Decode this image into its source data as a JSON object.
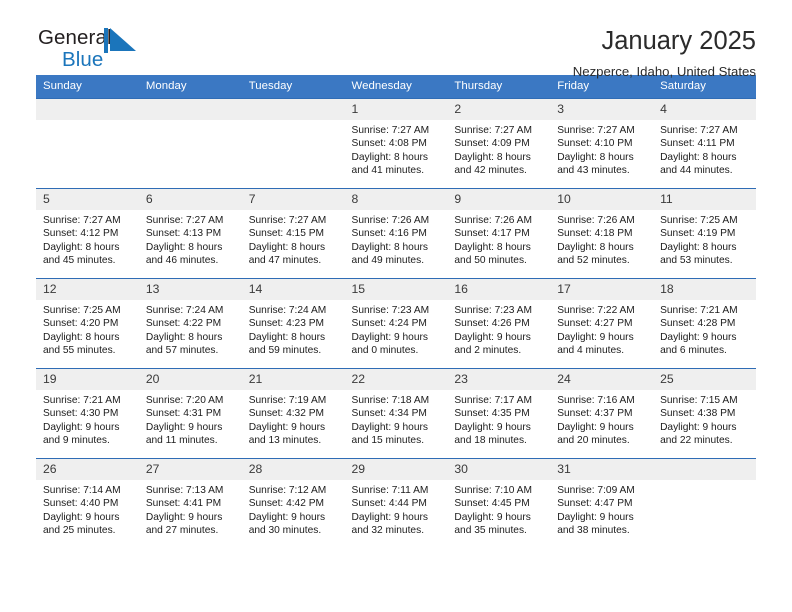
{
  "brand": {
    "name_part1": "General",
    "name_part2": "Blue",
    "mark_icon": "triangle-flag-icon",
    "accent_color": "#1b75bb"
  },
  "header": {
    "title": "January 2025",
    "subtitle": "Nezperce, Idaho, United States"
  },
  "theme": {
    "header_bar_color": "#3b78c3",
    "day_band_color": "#efefef",
    "row_rule_color": "#2f6cb5"
  },
  "weekdays": [
    "Sunday",
    "Monday",
    "Tuesday",
    "Wednesday",
    "Thursday",
    "Friday",
    "Saturday"
  ],
  "weeks": [
    [
      {
        "day": "",
        "lines": []
      },
      {
        "day": "",
        "lines": []
      },
      {
        "day": "",
        "lines": []
      },
      {
        "day": "1",
        "lines": [
          "Sunrise: 7:27 AM",
          "Sunset: 4:08 PM",
          "Daylight: 8 hours",
          "and 41 minutes."
        ]
      },
      {
        "day": "2",
        "lines": [
          "Sunrise: 7:27 AM",
          "Sunset: 4:09 PM",
          "Daylight: 8 hours",
          "and 42 minutes."
        ]
      },
      {
        "day": "3",
        "lines": [
          "Sunrise: 7:27 AM",
          "Sunset: 4:10 PM",
          "Daylight: 8 hours",
          "and 43 minutes."
        ]
      },
      {
        "day": "4",
        "lines": [
          "Sunrise: 7:27 AM",
          "Sunset: 4:11 PM",
          "Daylight: 8 hours",
          "and 44 minutes."
        ]
      }
    ],
    [
      {
        "day": "5",
        "lines": [
          "Sunrise: 7:27 AM",
          "Sunset: 4:12 PM",
          "Daylight: 8 hours",
          "and 45 minutes."
        ]
      },
      {
        "day": "6",
        "lines": [
          "Sunrise: 7:27 AM",
          "Sunset: 4:13 PM",
          "Daylight: 8 hours",
          "and 46 minutes."
        ]
      },
      {
        "day": "7",
        "lines": [
          "Sunrise: 7:27 AM",
          "Sunset: 4:15 PM",
          "Daylight: 8 hours",
          "and 47 minutes."
        ]
      },
      {
        "day": "8",
        "lines": [
          "Sunrise: 7:26 AM",
          "Sunset: 4:16 PM",
          "Daylight: 8 hours",
          "and 49 minutes."
        ]
      },
      {
        "day": "9",
        "lines": [
          "Sunrise: 7:26 AM",
          "Sunset: 4:17 PM",
          "Daylight: 8 hours",
          "and 50 minutes."
        ]
      },
      {
        "day": "10",
        "lines": [
          "Sunrise: 7:26 AM",
          "Sunset: 4:18 PM",
          "Daylight: 8 hours",
          "and 52 minutes."
        ]
      },
      {
        "day": "11",
        "lines": [
          "Sunrise: 7:25 AM",
          "Sunset: 4:19 PM",
          "Daylight: 8 hours",
          "and 53 minutes."
        ]
      }
    ],
    [
      {
        "day": "12",
        "lines": [
          "Sunrise: 7:25 AM",
          "Sunset: 4:20 PM",
          "Daylight: 8 hours",
          "and 55 minutes."
        ]
      },
      {
        "day": "13",
        "lines": [
          "Sunrise: 7:24 AM",
          "Sunset: 4:22 PM",
          "Daylight: 8 hours",
          "and 57 minutes."
        ]
      },
      {
        "day": "14",
        "lines": [
          "Sunrise: 7:24 AM",
          "Sunset: 4:23 PM",
          "Daylight: 8 hours",
          "and 59 minutes."
        ]
      },
      {
        "day": "15",
        "lines": [
          "Sunrise: 7:23 AM",
          "Sunset: 4:24 PM",
          "Daylight: 9 hours",
          "and 0 minutes."
        ]
      },
      {
        "day": "16",
        "lines": [
          "Sunrise: 7:23 AM",
          "Sunset: 4:26 PM",
          "Daylight: 9 hours",
          "and 2 minutes."
        ]
      },
      {
        "day": "17",
        "lines": [
          "Sunrise: 7:22 AM",
          "Sunset: 4:27 PM",
          "Daylight: 9 hours",
          "and 4 minutes."
        ]
      },
      {
        "day": "18",
        "lines": [
          "Sunrise: 7:21 AM",
          "Sunset: 4:28 PM",
          "Daylight: 9 hours",
          "and 6 minutes."
        ]
      }
    ],
    [
      {
        "day": "19",
        "lines": [
          "Sunrise: 7:21 AM",
          "Sunset: 4:30 PM",
          "Daylight: 9 hours",
          "and 9 minutes."
        ]
      },
      {
        "day": "20",
        "lines": [
          "Sunrise: 7:20 AM",
          "Sunset: 4:31 PM",
          "Daylight: 9 hours",
          "and 11 minutes."
        ]
      },
      {
        "day": "21",
        "lines": [
          "Sunrise: 7:19 AM",
          "Sunset: 4:32 PM",
          "Daylight: 9 hours",
          "and 13 minutes."
        ]
      },
      {
        "day": "22",
        "lines": [
          "Sunrise: 7:18 AM",
          "Sunset: 4:34 PM",
          "Daylight: 9 hours",
          "and 15 minutes."
        ]
      },
      {
        "day": "23",
        "lines": [
          "Sunrise: 7:17 AM",
          "Sunset: 4:35 PM",
          "Daylight: 9 hours",
          "and 18 minutes."
        ]
      },
      {
        "day": "24",
        "lines": [
          "Sunrise: 7:16 AM",
          "Sunset: 4:37 PM",
          "Daylight: 9 hours",
          "and 20 minutes."
        ]
      },
      {
        "day": "25",
        "lines": [
          "Sunrise: 7:15 AM",
          "Sunset: 4:38 PM",
          "Daylight: 9 hours",
          "and 22 minutes."
        ]
      }
    ],
    [
      {
        "day": "26",
        "lines": [
          "Sunrise: 7:14 AM",
          "Sunset: 4:40 PM",
          "Daylight: 9 hours",
          "and 25 minutes."
        ]
      },
      {
        "day": "27",
        "lines": [
          "Sunrise: 7:13 AM",
          "Sunset: 4:41 PM",
          "Daylight: 9 hours",
          "and 27 minutes."
        ]
      },
      {
        "day": "28",
        "lines": [
          "Sunrise: 7:12 AM",
          "Sunset: 4:42 PM",
          "Daylight: 9 hours",
          "and 30 minutes."
        ]
      },
      {
        "day": "29",
        "lines": [
          "Sunrise: 7:11 AM",
          "Sunset: 4:44 PM",
          "Daylight: 9 hours",
          "and 32 minutes."
        ]
      },
      {
        "day": "30",
        "lines": [
          "Sunrise: 7:10 AM",
          "Sunset: 4:45 PM",
          "Daylight: 9 hours",
          "and 35 minutes."
        ]
      },
      {
        "day": "31",
        "lines": [
          "Sunrise: 7:09 AM",
          "Sunset: 4:47 PM",
          "Daylight: 9 hours",
          "and 38 minutes."
        ]
      },
      {
        "day": "",
        "lines": []
      }
    ]
  ]
}
